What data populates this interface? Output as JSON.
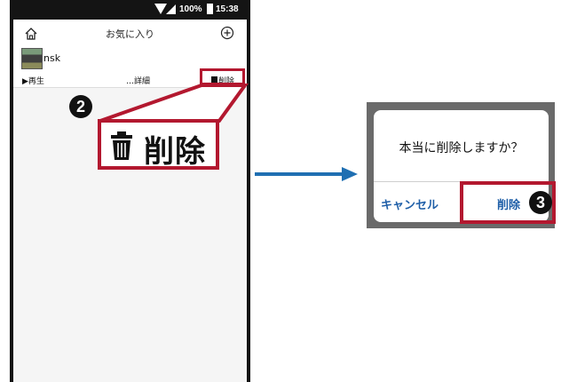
{
  "status_bar": {
    "battery": "100%",
    "time": "15:38"
  },
  "app_bar": {
    "title": "お気に入り"
  },
  "user": {
    "name": "nsk"
  },
  "actions": {
    "play": "▶再生",
    "details": "…詳細",
    "delete": "削除"
  },
  "callout": {
    "step": "2",
    "label": "削除"
  },
  "dialog": {
    "message": "本当に削除しますか？",
    "cancel": "キャンセル",
    "confirm": "削除",
    "step": "3"
  },
  "colors": {
    "highlight": "#b3182f",
    "arrow": "#1f6fb2",
    "link": "#1f5fa8"
  }
}
